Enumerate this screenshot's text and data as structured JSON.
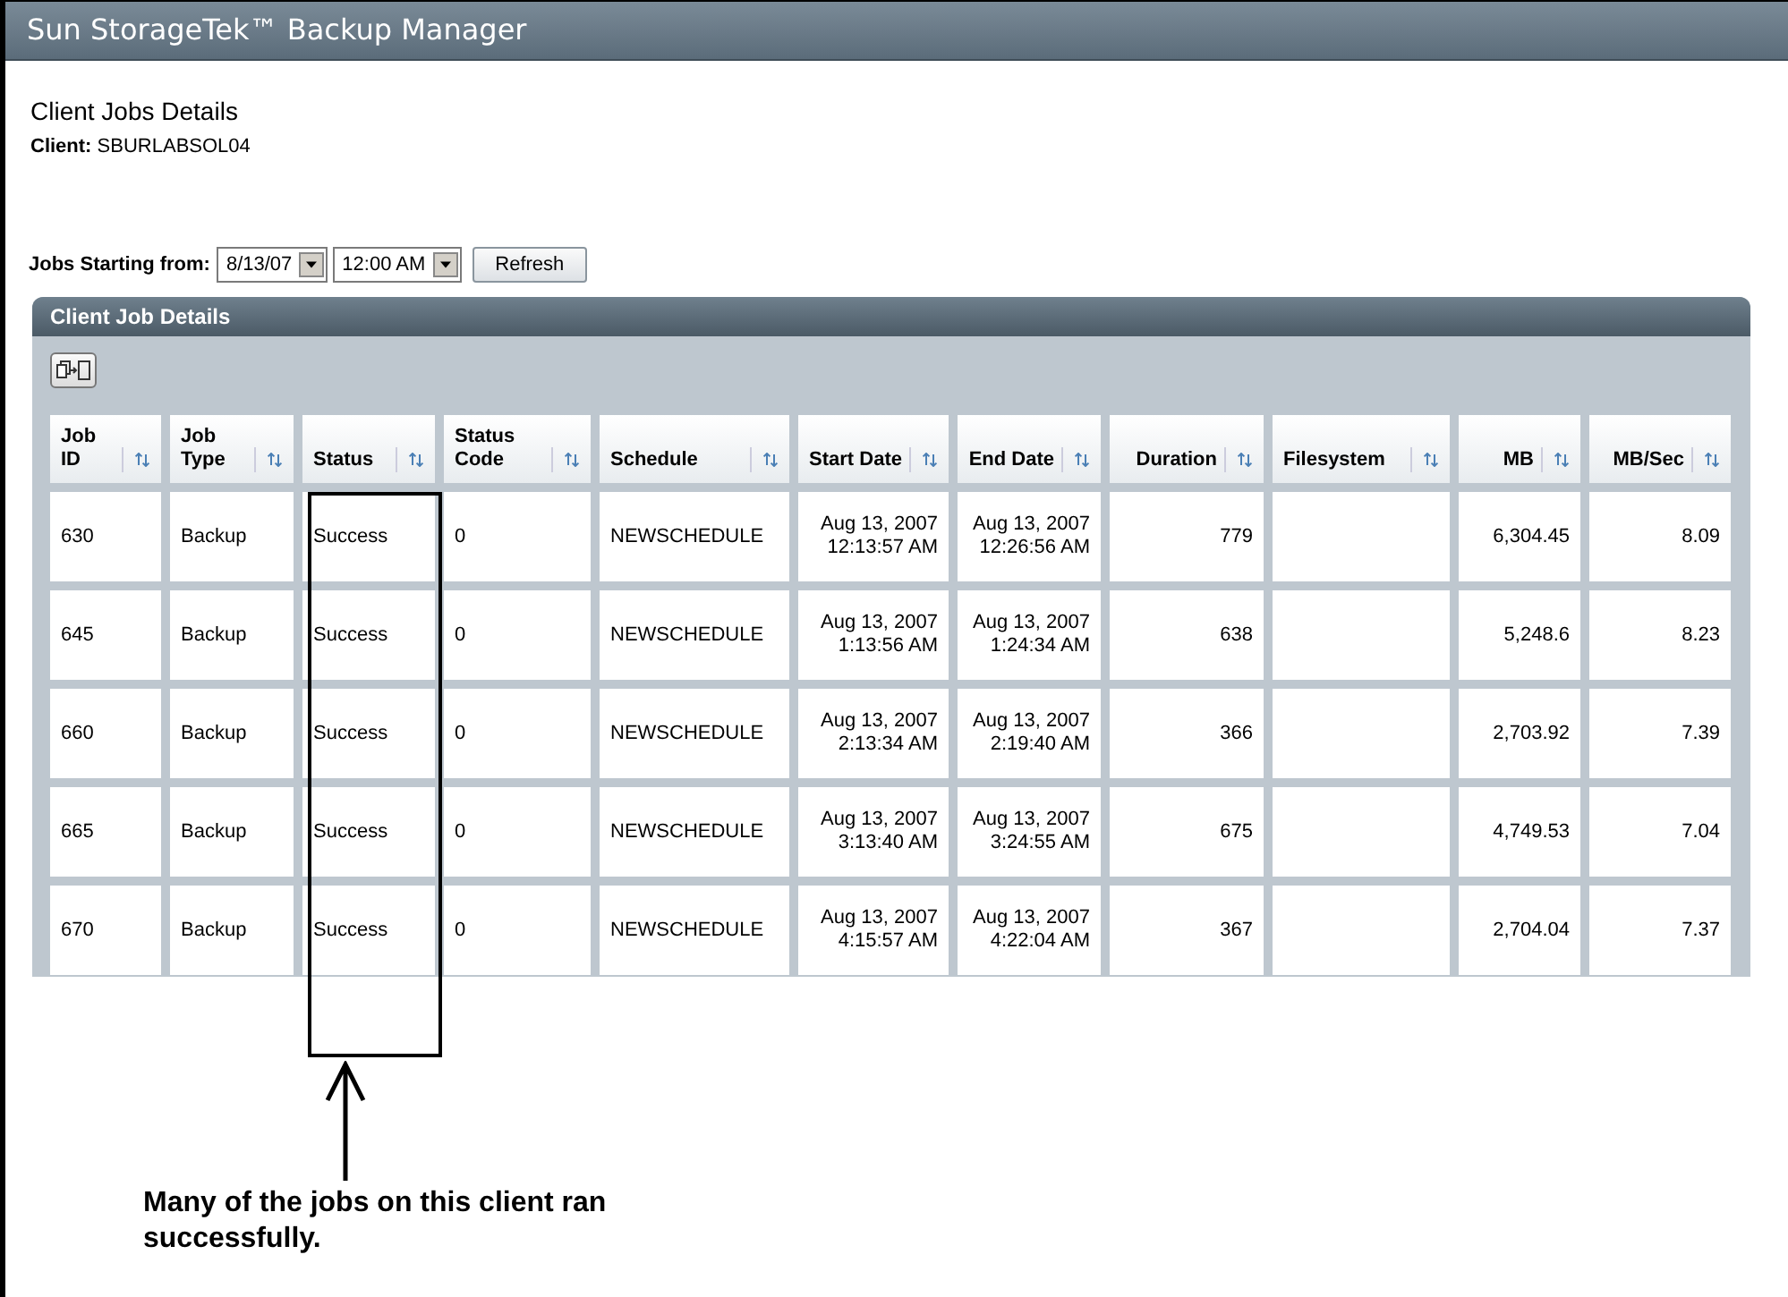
{
  "window": {
    "title": "Sun StorageTek™ Backup Manager"
  },
  "page": {
    "heading": "Client Jobs Details",
    "client_label": "Client:",
    "client_value": "SBURLABSOL04"
  },
  "filter": {
    "label": "Jobs Starting from:",
    "date": "8/13/07",
    "time": "12:00 AM",
    "refresh": "Refresh"
  },
  "panel": {
    "title": "Client Job Details"
  },
  "table": {
    "columns": [
      {
        "label": "Job ID",
        "numeric": false
      },
      {
        "label": "Job Type",
        "numeric": false
      },
      {
        "label": "Status",
        "numeric": false
      },
      {
        "label": "Status Code",
        "numeric": false
      },
      {
        "label": "Schedule",
        "numeric": false
      },
      {
        "label": "Start Date",
        "numeric": true
      },
      {
        "label": "End Date",
        "numeric": true
      },
      {
        "label": "Duration",
        "numeric": true
      },
      {
        "label": "Filesystem",
        "numeric": false
      },
      {
        "label": "MB",
        "numeric": true
      },
      {
        "label": "MB/Sec",
        "numeric": true
      }
    ],
    "rows": [
      [
        "630",
        "Backup",
        "Success",
        "0",
        "NEWSCHEDULE",
        "Aug 13, 2007 12:13:57 AM",
        "Aug 13, 2007 12:26:56 AM",
        "779",
        "",
        "6,304.45",
        "8.09"
      ],
      [
        "645",
        "Backup",
        "Success",
        "0",
        "NEWSCHEDULE",
        "Aug 13, 2007 1:13:56 AM",
        "Aug 13, 2007 1:24:34 AM",
        "638",
        "",
        "5,248.6",
        "8.23"
      ],
      [
        "660",
        "Backup",
        "Success",
        "0",
        "NEWSCHEDULE",
        "Aug 13, 2007 2:13:34 AM",
        "Aug 13, 2007 2:19:40 AM",
        "366",
        "",
        "2,703.92",
        "7.39"
      ],
      [
        "665",
        "Backup",
        "Success",
        "0",
        "NEWSCHEDULE",
        "Aug 13, 2007 3:13:40 AM",
        "Aug 13, 2007 3:24:55 AM",
        "675",
        "",
        "4,749.53",
        "7.04"
      ],
      [
        "670",
        "Backup",
        "Success",
        "0",
        "NEWSCHEDULE",
        "Aug 13, 2007 4:15:57 AM",
        "Aug 13, 2007 4:22:04 AM",
        "367",
        "",
        "2,704.04",
        "7.37"
      ]
    ]
  },
  "annotation": {
    "text": "Many of the jobs on this client ran successfully."
  }
}
